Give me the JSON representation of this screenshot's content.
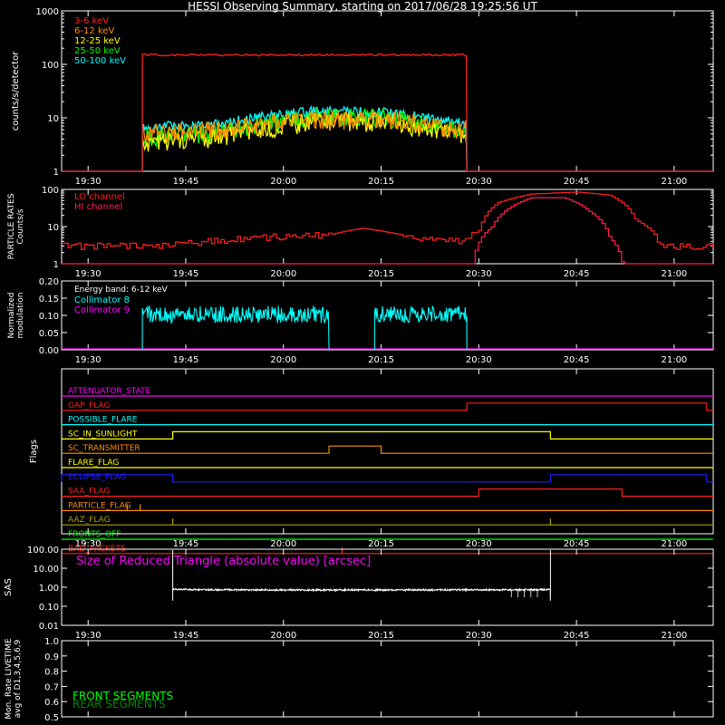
{
  "title": "HESSI Observing Summary, starting on 2017/06/28 19:25:56 UT",
  "time_ticks": [
    "19:30",
    "19:45",
    "20:00",
    "20:15",
    "20:30",
    "20:45",
    "21:00"
  ],
  "colors": {
    "red": "#ff2020",
    "orange": "#ff8c00",
    "yellow": "#ffff00",
    "green": "#00ff00",
    "cyan": "#00ffff",
    "magenta": "#ff00ff",
    "blue": "#2020ff",
    "crimson": "#ff2050",
    "olive": "#b0a000",
    "white": "#ffffff"
  },
  "chart_data": [
    {
      "type": "line",
      "panel": "counts",
      "ylabel": "counts/s/detector",
      "yscale": "log",
      "ylim": [
        1,
        1000
      ],
      "xlim_minutes": [
        19.5,
        21.6
      ],
      "y_tick_labels": [
        "1000",
        "100",
        "10",
        "1"
      ],
      "y_tick_values": [
        1000,
        100,
        10,
        1
      ],
      "series": [
        {
          "name": "3-6 keV",
          "color": "#ff2020",
          "x": [
            "19:25:56",
            "19:38:20",
            "19:38:20",
            "20:28:10",
            "20:28:10",
            "21:05"
          ],
          "values": [
            1,
            1,
            150,
            150,
            1,
            1
          ]
        },
        {
          "name": "6-12 keV",
          "color": "#ff8c00",
          "x": [
            "19:38:20",
            "19:50",
            "20:05",
            "20:15",
            "20:28:10"
          ],
          "values": [
            6,
            7,
            11,
            11,
            7
          ]
        },
        {
          "name": "12-25 keV",
          "color": "#ffff00",
          "x": [
            "19:38:20",
            "19:50",
            "20:05",
            "20:15",
            "20:28:10"
          ],
          "values": [
            4,
            5,
            10,
            10,
            5
          ]
        },
        {
          "name": "25-50 keV",
          "color": "#00ff00",
          "x": [
            "19:38:20",
            "19:50",
            "20:05",
            "20:15",
            "20:28:10"
          ],
          "values": [
            5,
            6,
            12,
            12,
            6
          ]
        },
        {
          "name": "50-100 keV",
          "color": "#00ffff",
          "x": [
            "19:25:56",
            "19:38:20",
            "19:38:20",
            "19:50",
            "20:05",
            "20:15",
            "20:28:10",
            "20:28:10",
            "21:05"
          ],
          "values": [
            1,
            1,
            7,
            8,
            14,
            13,
            8,
            1,
            1
          ]
        }
      ]
    },
    {
      "type": "line",
      "panel": "particle",
      "ylabel_lines": [
        "PARTICLE RATES",
        "Counts/s"
      ],
      "yscale": "log",
      "ylim": [
        1,
        100
      ],
      "y_tick_labels": [
        "100",
        "10",
        "1"
      ],
      "y_tick_values": [
        100,
        10,
        1
      ],
      "series": [
        {
          "name": "LO channel",
          "color": "#ff2020",
          "x": [
            "19:25:56",
            "19:36",
            "19:40",
            "19:45",
            "19:55",
            "20:07",
            "20:12",
            "20:20",
            "20:28",
            "20:30",
            "20:33",
            "20:38",
            "20:45",
            "20:50",
            "20:54",
            "20:58",
            "21:05"
          ],
          "values": [
            3,
            3,
            3,
            3.5,
            5,
            6,
            9,
            5,
            4,
            8,
            45,
            75,
            85,
            70,
            15,
            3,
            3
          ]
        },
        {
          "name": "HI channel",
          "color": "#ff2050",
          "x": [
            "19:25:56",
            "20:29",
            "20:32",
            "20:38",
            "20:43",
            "20:47",
            "20:50",
            "20:52",
            "21:05"
          ],
          "values": [
            1,
            1,
            10,
            60,
            60,
            25,
            5,
            1,
            1
          ]
        }
      ]
    },
    {
      "type": "line",
      "panel": "modulation",
      "ylabel_lines": [
        "Normalized",
        "modulation"
      ],
      "ylim": [
        0,
        0.2
      ],
      "y_tick_labels": [
        "0.20",
        "0.15",
        "0.10",
        "0.05",
        "0.00"
      ],
      "y_tick_values": [
        0.2,
        0.15,
        0.1,
        0.05,
        0.0
      ],
      "annotation": "Energy band: 6-12 keV",
      "series": [
        {
          "name": "Collimator 8",
          "color": "#00ffff",
          "segments": [
            [
              "19:38:20",
              "20:07"
            ],
            [
              "20:14",
              "20:28:10"
            ]
          ],
          "level": 0.1
        },
        {
          "name": "Collimator 9",
          "color": "#ff00ff",
          "level": 0.0
        }
      ]
    },
    {
      "type": "line",
      "panel": "flags",
      "ylabel": "Flags",
      "flags": [
        {
          "name": "ATTENUATOR_STATE",
          "color": "#ff00ff",
          "high": []
        },
        {
          "name": "GAP_FLAG",
          "color": "#ff2020",
          "high": [
            [
              "20:28:10",
              "21:05"
            ]
          ]
        },
        {
          "name": "POSSIBLE_FLARE",
          "color": "#00ffff",
          "high": []
        },
        {
          "name": "SC_IN_SUNLIGHT",
          "color": "#ffff00",
          "high": [
            [
              "19:43",
              "20:41"
            ]
          ]
        },
        {
          "name": "SC_TRANSMITTER",
          "color": "#ff8c00",
          "high": [
            [
              "20:07",
              "20:15"
            ]
          ]
        },
        {
          "name": "FLARE_FLAG",
          "color": "#ffff00",
          "high": []
        },
        {
          "name": "ECLIPSE_FLAG",
          "color": "#2020ff",
          "high": [
            [
              "19:25:56",
              "19:43"
            ],
            [
              "20:41",
              "21:05"
            ]
          ]
        },
        {
          "name": "SAA_FLAG",
          "color": "#ff2020",
          "high": [
            [
              "20:30",
              "20:52"
            ]
          ]
        },
        {
          "name": "PARTICLE_FLAG",
          "color": "#ff8c00",
          "high": []
        },
        {
          "name": "AAZ_FLAG",
          "color": "#b0a000",
          "high": []
        },
        {
          "name": "FRONTS_OFF",
          "color": "#00ff00",
          "high": []
        },
        {
          "name": "BAD_PACKETS",
          "color": "#ff2020",
          "high": []
        }
      ]
    },
    {
      "type": "line",
      "panel": "sas",
      "ylabel": "SAS",
      "yscale": "log",
      "ylim": [
        0.01,
        100
      ],
      "y_tick_labels": [
        "100.00",
        "10.00",
        "1.00",
        "0.10",
        "0.01"
      ],
      "y_tick_values": [
        100,
        10,
        1,
        0.1,
        0.01
      ],
      "annotation": "Size of Reduced Triangle (absolute value) [arcsec]",
      "series": [
        {
          "name": "SAS",
          "color": "#ffffff",
          "x": [
            "19:43",
            "19:45",
            "20:00",
            "20:20",
            "20:41"
          ],
          "values": [
            0.8,
            0.75,
            0.72,
            0.72,
            0.75
          ]
        }
      ]
    },
    {
      "type": "line",
      "panel": "livetime",
      "ylabel_lines": [
        "Mon. Rate LIVETIME",
        "avg of D1,3,4,5,6,9"
      ],
      "ylim": [
        0.5,
        1.0
      ],
      "y_tick_labels": [
        "1.0",
        "0.9",
        "0.8",
        "0.7",
        "0.6",
        "0.5"
      ],
      "y_tick_values": [
        1.0,
        0.9,
        0.8,
        0.7,
        0.6,
        0.5
      ],
      "series": [
        {
          "name": "FRONT SEGMENTS",
          "color": "#00ff00",
          "values": []
        },
        {
          "name": "REAR SEGMENTS",
          "color": "#008800",
          "values": []
        }
      ]
    }
  ]
}
